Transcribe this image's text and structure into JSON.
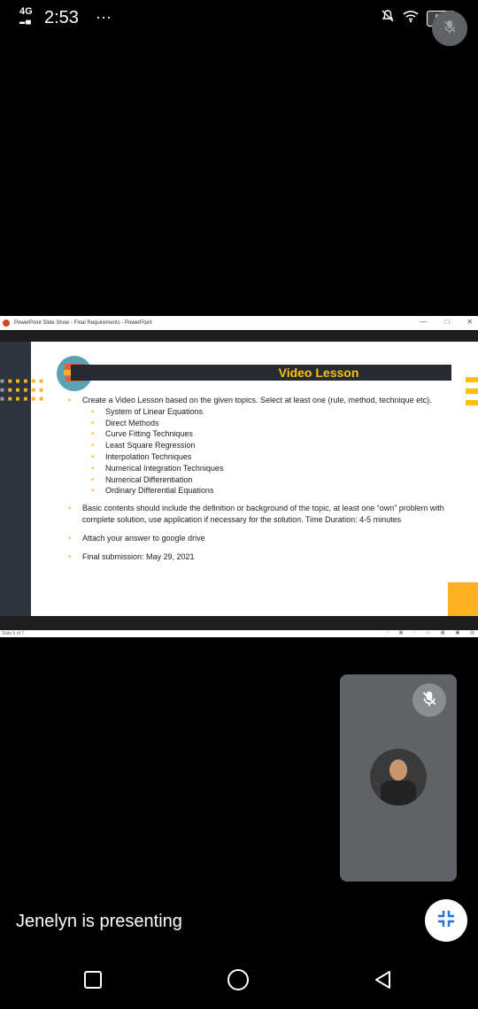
{
  "status_bar": {
    "network": "4G",
    "time": "2:53",
    "overflow": "···",
    "battery": "57"
  },
  "window": {
    "title": "PowerPoint Slide Show - Final Requirements - PowerPoint",
    "minimize": "—",
    "maximize": "□",
    "close": "✕"
  },
  "slide": {
    "title": "Video Lesson",
    "intro": "Create a Video Lesson based on the given topics. Select at least one (rule, method, technique etc).",
    "topics": [
      "System of Linear Equations",
      "Direct Methods",
      "Curve Fitting Techniques",
      "Least Square Regression",
      "Interpolation Techniques",
      "Numerical Integration Techniques",
      "Numerical Differentiation",
      "Ordinary Differential Equations"
    ],
    "basic": "Basic contents should include the definition or background of the topic, at least one “own” problem with complete solution, use application if necessary for the solution. Time Duration: 4-5 minutes",
    "attach": "Attach your answer to google drive",
    "submission": "Final submission: May 29, 2021"
  },
  "slide_status": {
    "counter": "Slide 5 of 7"
  },
  "meeting": {
    "presenting_text": "Jenelyn is presenting"
  },
  "icons": {
    "mic_off": "mic-off-icon",
    "exit_fullscreen": "collapse-icon",
    "nav_recents": "square-icon",
    "nav_home": "circle-icon",
    "nav_back": "triangle-icon"
  },
  "colors": {
    "accent": "#ffc000",
    "panel": "#2e3440",
    "tile": "#5f6368",
    "exit_icon": "#1a73e8"
  }
}
